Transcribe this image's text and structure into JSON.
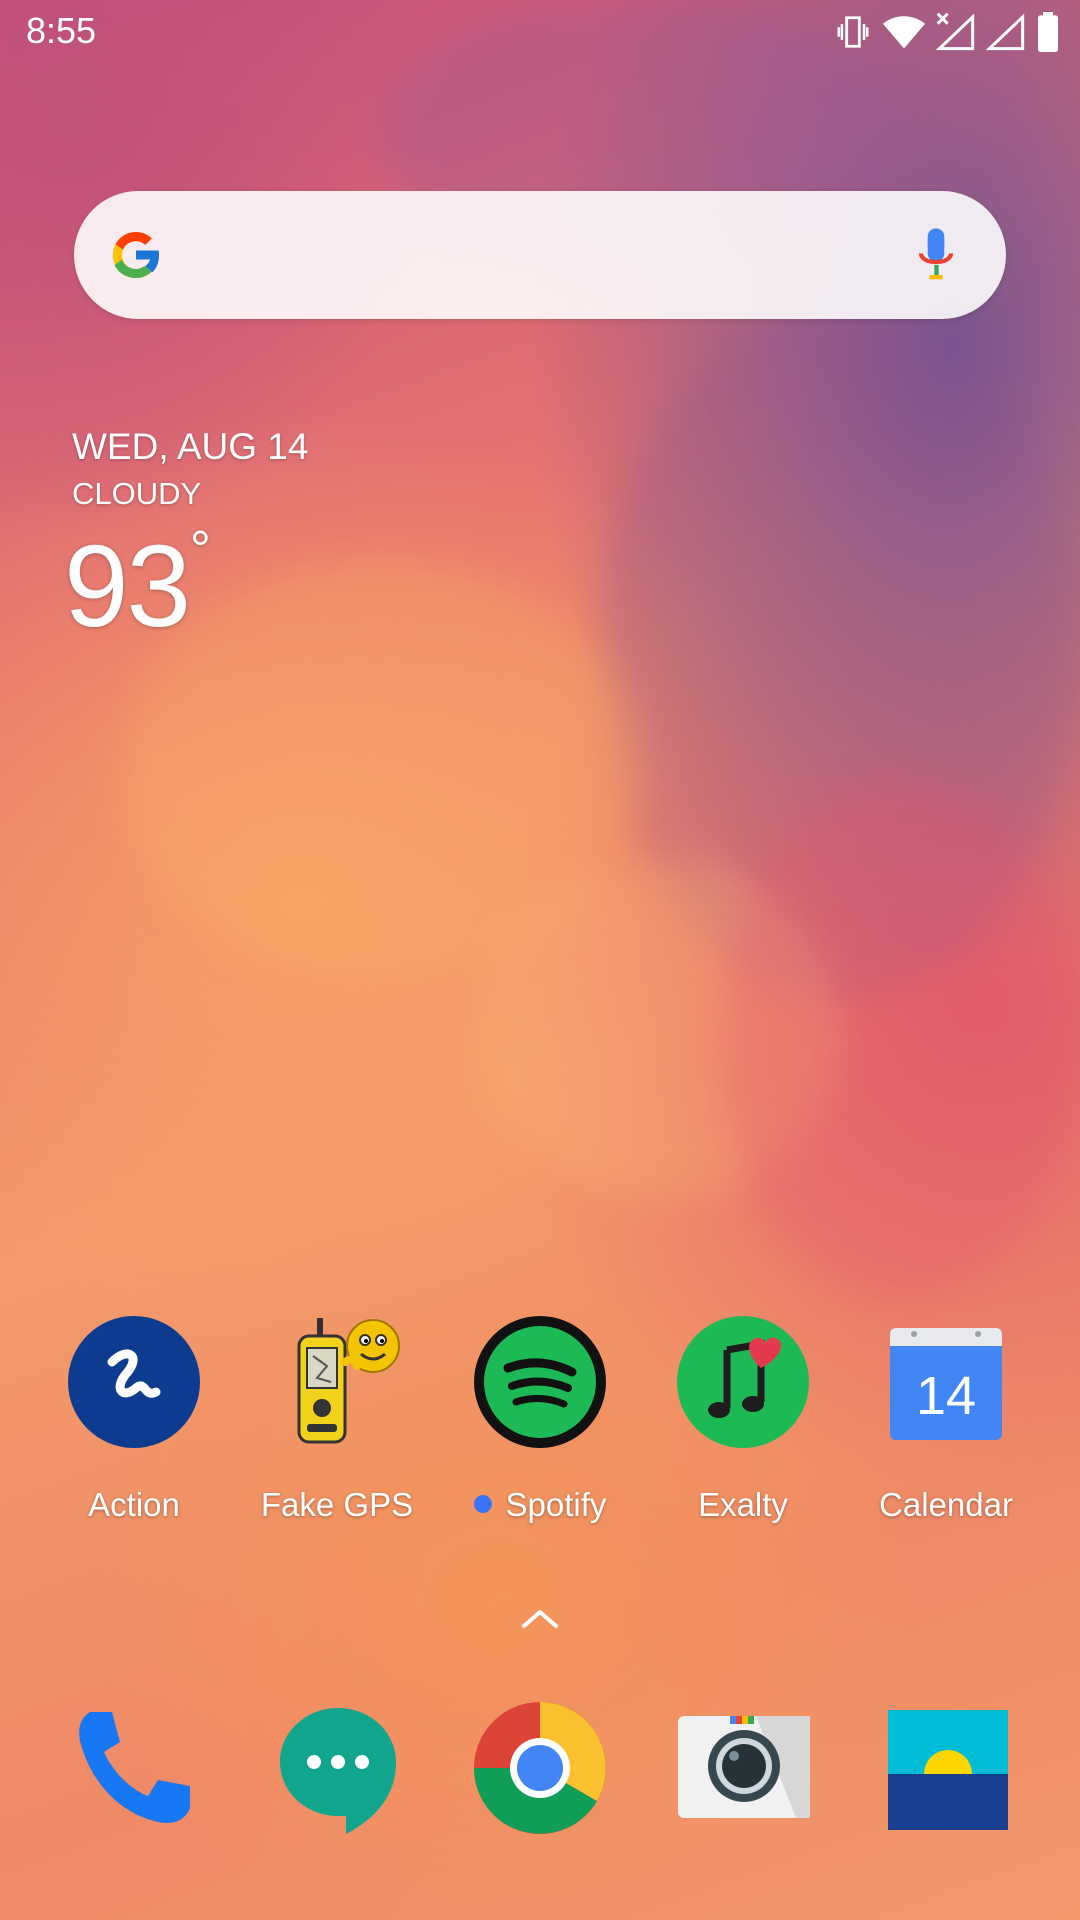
{
  "status_bar": {
    "time": "8:55",
    "icons": [
      "vibrate-icon",
      "wifi-icon",
      "signal-x-icon",
      "signal-icon",
      "battery-icon"
    ]
  },
  "search": {
    "logo": "google-g-icon",
    "mic": "mic-icon"
  },
  "weather_widget": {
    "date": "WED, AUG 14",
    "condition": "CLOUDY",
    "temperature": "93",
    "degree_symbol": "°"
  },
  "apps": [
    {
      "label": "Action",
      "icon": "action-icon"
    },
    {
      "label": "Fake GPS",
      "icon": "fake-gps-icon"
    },
    {
      "label": "Spotify",
      "icon": "spotify-icon",
      "new_badge": true
    },
    {
      "label": "Exalty",
      "icon": "exalty-icon"
    },
    {
      "label": "Calendar",
      "icon": "calendar-icon",
      "calendar_day": "14"
    }
  ],
  "dock": [
    {
      "icon": "phone-icon"
    },
    {
      "icon": "messages-icon"
    },
    {
      "icon": "chrome-icon"
    },
    {
      "icon": "camera-icon"
    },
    {
      "icon": "gallery-icon"
    }
  ],
  "colors": {
    "spotify_green": "#1db954",
    "action_blue": "#0d3b8f",
    "exalty_green": "#1db954",
    "calendar_blue": "#4285f4",
    "phone_blue": "#1877f2",
    "messages_teal": "#10a58c"
  }
}
